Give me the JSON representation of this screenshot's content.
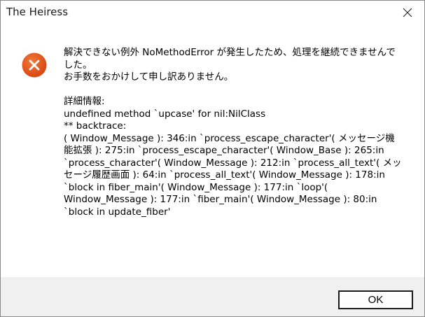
{
  "window": {
    "title": "The Heiress",
    "close_icon": "close-icon",
    "error_icon": "error-circle-icon",
    "error_icon_color": "#e24b1c"
  },
  "dialog": {
    "message": "解決できない例外 NoMethodError が発生したため、処理を継続できませんでした。\nお手数をおかけして申し訳ありません。\n\n詳細情報:\nundefined method `upcase' for nil:NilClass\n** backtrace:\n( Window_Message ): 346:in `process_escape_character'( メッセージ機能拡張 ): 275:in `process_escape_character'( Window_Base ): 265:in `process_character'( Window_Message ): 212:in `process_all_text'( メッセージ履歴画面 ): 64:in `process_all_text'( Window_Message ): 178:in `block in fiber_main'( Window_Message ): 177:in `loop'( Window_Message ): 177:in `fiber_main'( Window_Message ): 80:in `block in update_fiber'"
  },
  "buttons": {
    "ok_label": "OK"
  }
}
